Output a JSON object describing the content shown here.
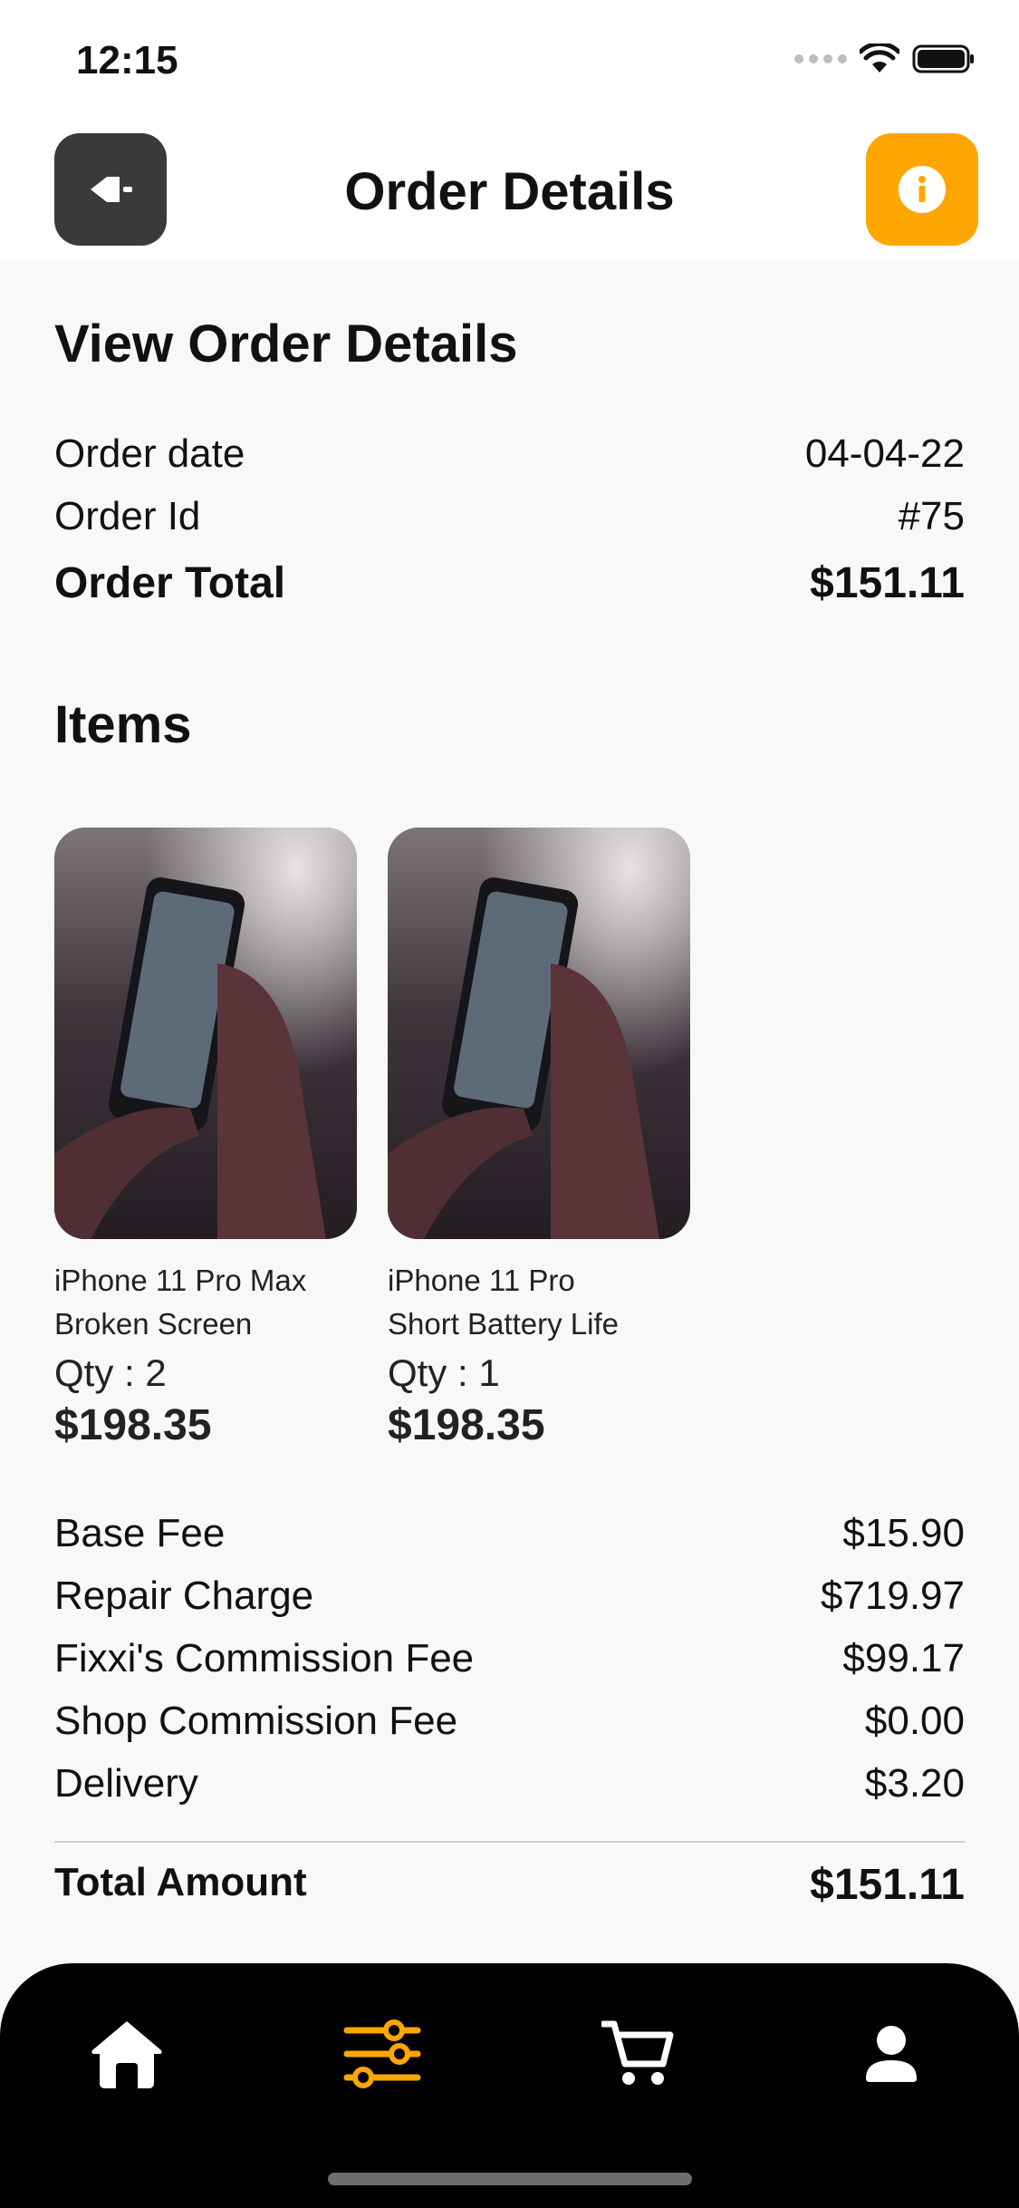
{
  "status": {
    "time": "12:15"
  },
  "header": {
    "title": "Order Details"
  },
  "summary": {
    "title": "View Order Details",
    "date_label": "Order date",
    "date_value": "04-04-22",
    "id_label": "Order Id",
    "id_value": "#75",
    "total_label": "Order Total",
    "total_value": "$151.11"
  },
  "items_title": "Items",
  "items": [
    {
      "name_line1": "iPhone 11 Pro Max",
      "name_line2": "Broken Screen",
      "qty": "Qty : 2",
      "price": "$198.35"
    },
    {
      "name_line1": "iPhone 11 Pro",
      "name_line2": "Short Battery Life",
      "qty": "Qty : 1",
      "price": "$198.35"
    }
  ],
  "fees": [
    {
      "label": "Base Fee",
      "value": "$15.90"
    },
    {
      "label": "Repair Charge",
      "value": "$719.97"
    },
    {
      "label": "Fixxi's Commission Fee",
      "value": "$99.17"
    },
    {
      "label": "Shop Commission Fee",
      "value": "$0.00"
    },
    {
      "label": "Delivery",
      "value": "$3.20"
    }
  ],
  "total": {
    "label": "Total Amount",
    "value": "$151.11"
  },
  "nav": {
    "items": [
      "home-icon",
      "filters-icon",
      "cart-icon",
      "profile-icon"
    ],
    "active": "filters-icon"
  },
  "colors": {
    "accent": "#ffa600",
    "dark": "#3a3a3a",
    "nav_bg": "#000000"
  }
}
